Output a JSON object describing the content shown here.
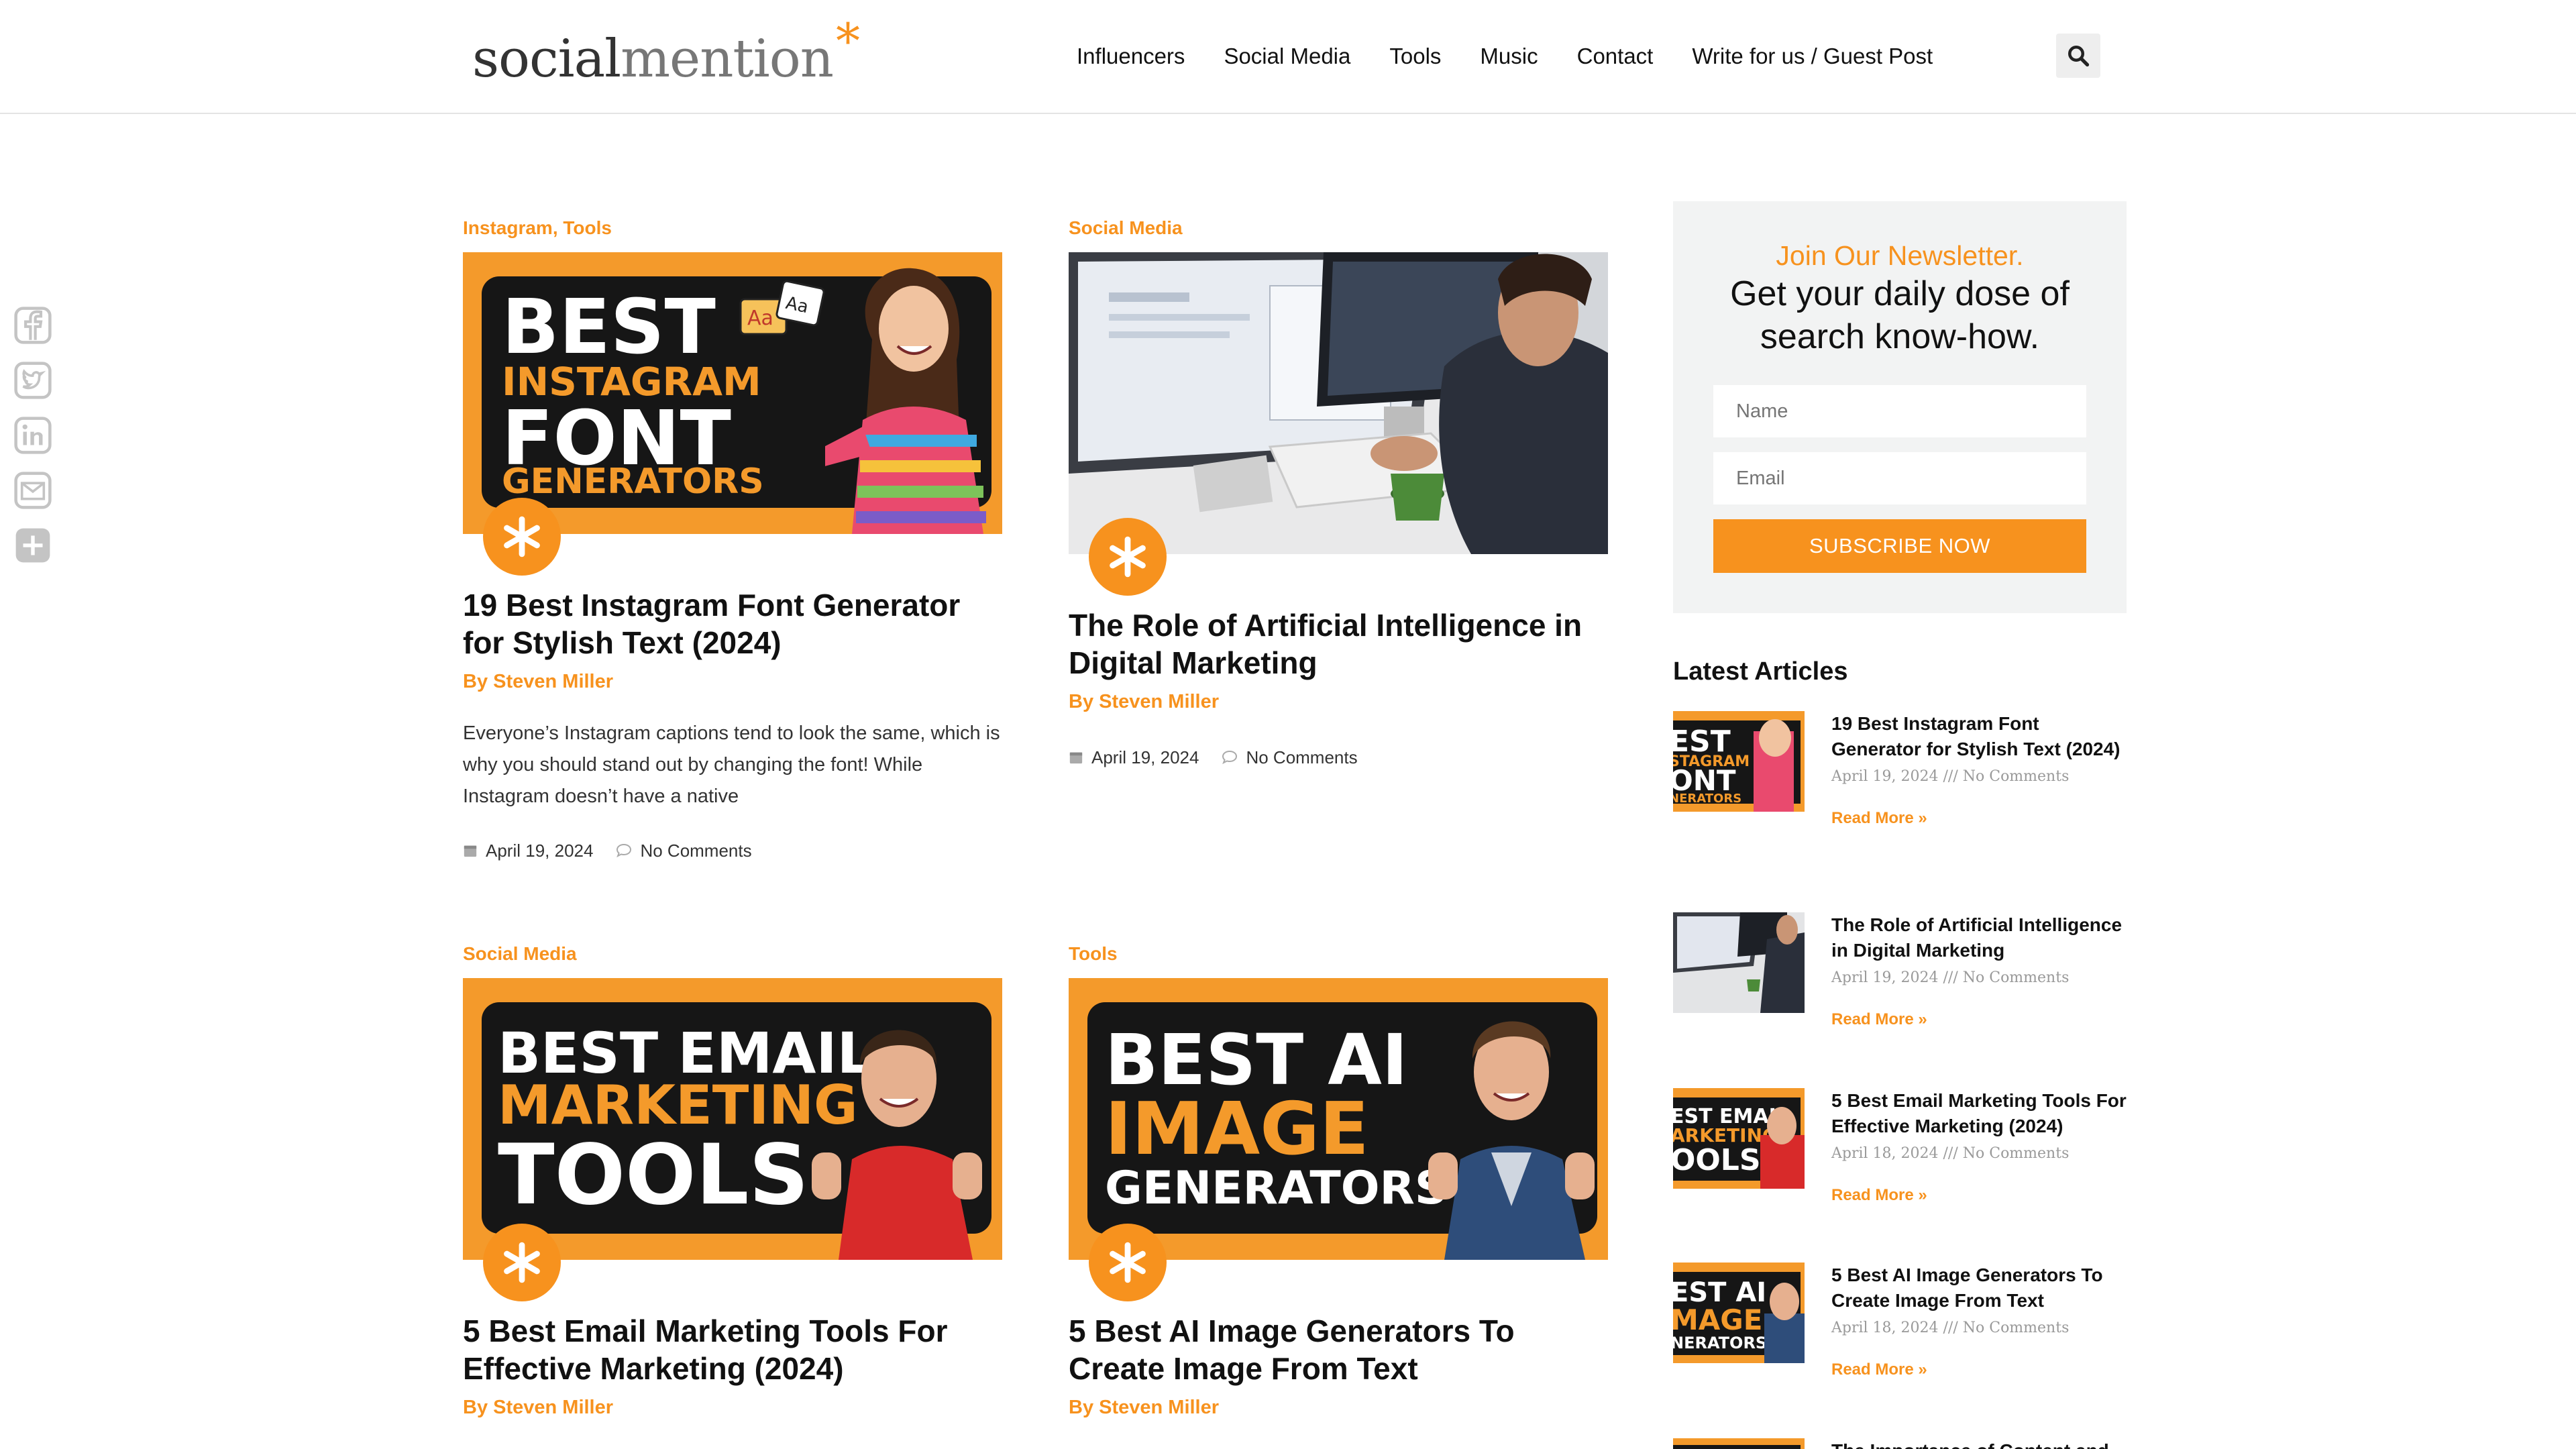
{
  "site": {
    "logo_a": "social",
    "logo_b": "mention",
    "logo_star": "*"
  },
  "nav": [
    "Influencers",
    "Social Media",
    "Tools",
    "Music",
    "Contact",
    "Write for us / Guest Post"
  ],
  "share_icons": [
    "facebook-icon",
    "twitter-icon",
    "linkedin-icon",
    "email-icon",
    "share-plus-icon"
  ],
  "posts": [
    {
      "category": "Instagram, Tools",
      "thumb_lines": [
        "BEST",
        "INSTAGRAM",
        "FONT",
        "GENERATORS"
      ],
      "title": "19 Best Instagram Font Generator for Stylish Text (2024)",
      "author": "By Steven Miller",
      "excerpt": "Everyone’s Instagram captions tend to look the same, which is why you should stand out by changing the font! While Instagram doesn’t have a native",
      "date": "April 19, 2024",
      "comments": "No Comments"
    },
    {
      "category": "Social Media",
      "title": "The Role of Artificial Intelligence in Digital Marketing",
      "author": "By Steven Miller",
      "date": "April 19, 2024",
      "comments": "No Comments"
    },
    {
      "category": "Social Media",
      "thumb_lines": [
        "BEST EMAIL",
        "MARKETING",
        "TOOLS"
      ],
      "title": "5 Best Email Marketing Tools For Effective Marketing (2024)",
      "author": "By Steven Miller"
    },
    {
      "category": "Tools",
      "thumb_lines": [
        "BEST AI",
        "IMAGE",
        "GENERATORS"
      ],
      "title": "5 Best AI Image Generators To Create Image From Text",
      "author": "By Steven Miller"
    }
  ],
  "newsletter": {
    "kicker": "Join Our Newsletter.",
    "headline": "Get your daily dose of search know-how.",
    "name_placeholder": "Name",
    "email_placeholder": "Email",
    "button": "SUBSCRIBE NOW"
  },
  "latest": {
    "heading": "Latest Articles",
    "items": [
      {
        "title": "19 Best Instagram Font Generator for Stylish Text (2024)",
        "meta": "April 19, 2024 /// No Comments",
        "more": "Read More »"
      },
      {
        "title": "The Role of Artificial Intelligence in Digital Marketing",
        "meta": "April 19, 2024 /// No Comments",
        "more": "Read More »"
      },
      {
        "title": "5 Best Email Marketing Tools For Effective Marketing (2024)",
        "meta": "April 18, 2024 /// No Comments",
        "more": "Read More »"
      },
      {
        "title": "5 Best AI Image Generators To Create Image From Text",
        "meta": "April 18, 2024 /// No Comments",
        "more": "Read More »"
      },
      {
        "title": "The Importance of Content and"
      }
    ]
  },
  "colors": {
    "accent": "#f7921e",
    "text": "#111111",
    "sidebar_bg": "#f2f3f3"
  }
}
